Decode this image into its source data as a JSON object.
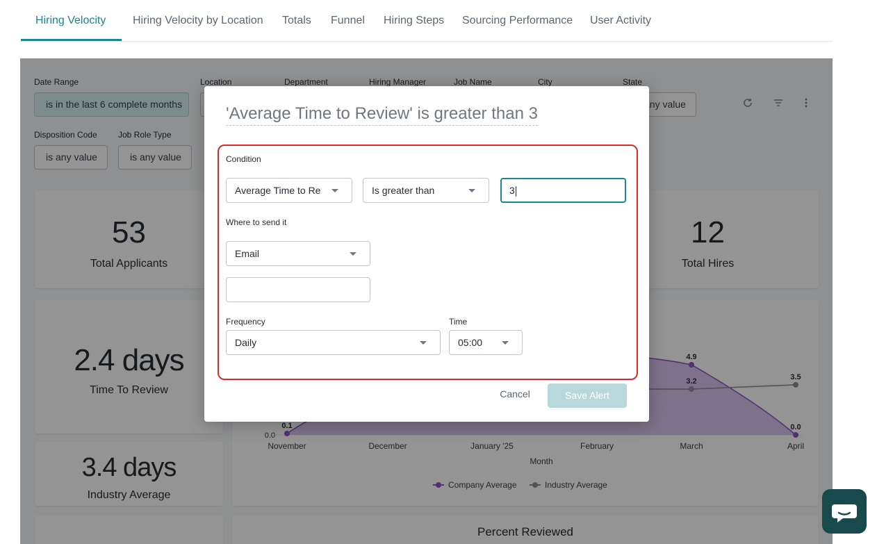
{
  "tabs": [
    {
      "label": "Hiring Velocity",
      "active": true
    },
    {
      "label": "Hiring Velocity by Location"
    },
    {
      "label": "Totals"
    },
    {
      "label": "Funnel"
    },
    {
      "label": "Hiring Steps"
    },
    {
      "label": "Sourcing Performance"
    },
    {
      "label": "User Activity"
    }
  ],
  "filters": {
    "date_range": {
      "label": "Date Range",
      "value": "is in the last 6 complete months"
    },
    "location": {
      "label": "Location"
    },
    "department": {
      "label": "Department"
    },
    "hiring_manager": {
      "label": "Hiring Manager"
    },
    "job_name": {
      "label": "Job Name"
    },
    "city": {
      "label": "City"
    },
    "state": {
      "label": "State",
      "value": "is any value"
    },
    "disposition_code": {
      "label": "Disposition Code",
      "value": "is any value"
    },
    "job_role_type": {
      "label": "Job Role Type",
      "value": "is any value"
    }
  },
  "toolbar_icons": [
    "refresh-icon",
    "filter-icon",
    "more-vertical-icon"
  ],
  "cards": {
    "total_applicants": {
      "value": "53",
      "label": "Total Applicants"
    },
    "total_hires": {
      "value": "12",
      "label": "Total Hires"
    },
    "time_to_review": {
      "value": "2.4 days",
      "label": "Time To Review"
    },
    "industry_average": {
      "value": "3.4 days",
      "label": "Industry Average"
    },
    "percent_reviewed_title": "Percent Reviewed"
  },
  "chart_data": {
    "type": "line",
    "x": [
      "November",
      "December",
      "January '25",
      "February",
      "March",
      "April"
    ],
    "xlabel": "Month",
    "series": [
      {
        "name": "Company Average",
        "color": "#8e54c9",
        "visible_values": {
          "November": 0.1,
          "March": 4.9,
          "April": 0.0
        }
      },
      {
        "name": "Industry Average",
        "color": "#8c8f94",
        "visible_values": {
          "March": 3.2,
          "April": 3.5
        }
      }
    ],
    "y_tick_labels": [
      "0.0"
    ],
    "data_labels": [
      "0.1",
      "4.9",
      "3.2",
      "3.5",
      "0.0"
    ],
    "legend_position": "bottom"
  },
  "modal": {
    "title": "'Average Time to Review' is greater than 3",
    "condition_label": "Condition",
    "field_value": "Average Time to Review",
    "operator_value": "Is greater than",
    "threshold_value": "3",
    "where_label": "Where to send it",
    "channel_value": "Email",
    "recipient_value": "",
    "frequency_label": "Frequency",
    "frequency_value": "Daily",
    "time_label": "Time",
    "time_value": "05:00",
    "cancel_label": "Cancel",
    "save_label": "Save Alert",
    "highlight_color": "#d92b2b"
  },
  "chat_icon": "chat-bubble-icon"
}
